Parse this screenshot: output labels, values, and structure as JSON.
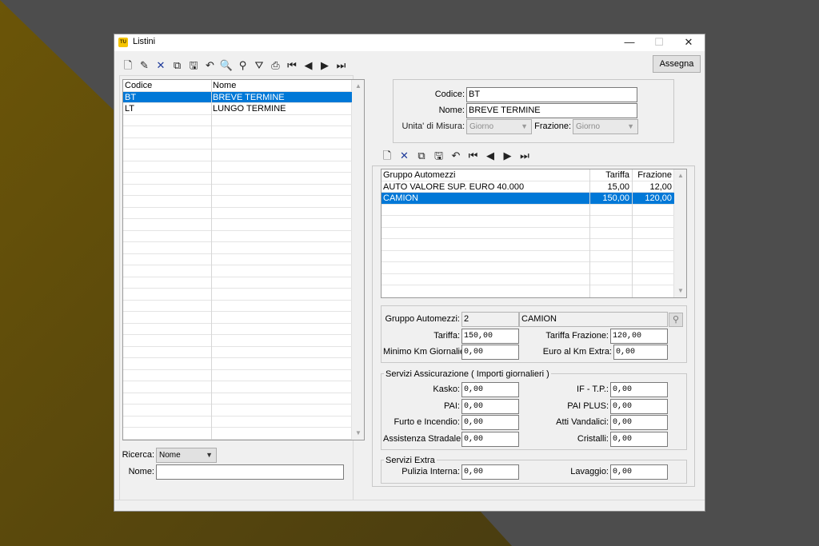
{
  "window": {
    "title": "Listini",
    "icon_text": "TU",
    "controls": {
      "minimize": "—",
      "maximize": "☐",
      "close": "✕"
    }
  },
  "toolbar": {
    "icons": [
      {
        "name": "new-document-icon",
        "glyph": "🗋"
      },
      {
        "name": "edit-pencil-icon",
        "glyph": "✎"
      },
      {
        "name": "delete-x-icon",
        "glyph": "✕"
      },
      {
        "name": "copy-icon",
        "glyph": "⧉"
      },
      {
        "name": "save-disk-icon",
        "glyph": "🖫"
      },
      {
        "name": "undo-icon",
        "glyph": "↶"
      },
      {
        "name": "search-icon",
        "glyph": "🔍"
      },
      {
        "name": "binoculars-icon",
        "glyph": "⚲"
      },
      {
        "name": "filter-icon",
        "glyph": "⛛"
      },
      {
        "name": "print-icon",
        "glyph": "⎙"
      },
      {
        "name": "first-record-icon",
        "glyph": "⏮"
      },
      {
        "name": "prev-record-icon",
        "glyph": "◀"
      },
      {
        "name": "next-record-icon",
        "glyph": "▶"
      },
      {
        "name": "last-record-icon",
        "glyph": "⏭"
      }
    ],
    "assegna_label": "Assegna"
  },
  "list": {
    "columns": [
      "Codice",
      "Nome"
    ],
    "rows": [
      {
        "codice": "BT",
        "nome": "BREVE TERMINE",
        "selected": true
      },
      {
        "codice": "LT",
        "nome": "LUNGO TERMINE",
        "selected": false
      }
    ],
    "empty_rows": 28
  },
  "search": {
    "ricerca_label": "Ricerca:",
    "ricerca_value": "Nome",
    "nome_label": "Nome:",
    "nome_value": ""
  },
  "header_form": {
    "codice_label": "Codice:",
    "codice_value": "BT",
    "nome_label": "Nome:",
    "nome_value": "BREVE TERMINE",
    "unita_label": "Unita' di Misura:",
    "unita_value": "Giorno",
    "frazione_label": "Frazione:",
    "frazione_value": "Giorno"
  },
  "sub_toolbar": {
    "icons": [
      {
        "name": "new-document-icon",
        "glyph": "🗋"
      },
      {
        "name": "delete-x-icon",
        "glyph": "✕"
      },
      {
        "name": "copy-icon",
        "glyph": "⧉"
      },
      {
        "name": "save-disk-icon",
        "glyph": "🖫"
      },
      {
        "name": "undo-icon",
        "glyph": "↶"
      },
      {
        "name": "first-record-icon",
        "glyph": "⏮"
      },
      {
        "name": "prev-record-icon",
        "glyph": "◀"
      },
      {
        "name": "next-record-icon",
        "glyph": "▶"
      },
      {
        "name": "last-record-icon",
        "glyph": "⏭"
      }
    ]
  },
  "tariff_grid": {
    "columns": [
      "Gruppo Automezzi",
      "Tariffa",
      "Frazione"
    ],
    "rows": [
      {
        "gruppo": "AUTO VALORE SUP. EURO 40.000",
        "tariffa": "15,00",
        "frazione": "12,00",
        "selected": false
      },
      {
        "gruppo": "CAMION",
        "tariffa": "150,00",
        "frazione": "120,00",
        "selected": true
      }
    ],
    "empty_rows": 7
  },
  "detail": {
    "gruppo_label": "Gruppo Automezzi:",
    "gruppo_code": "2",
    "gruppo_name": "CAMION",
    "tariffa_label": "Tariffa:",
    "tariffa_value": "150,00",
    "tariffa_frazione_label": "Tariffa Frazione:",
    "tariffa_frazione_value": "120,00",
    "minimo_km_label": "Minimo Km Giornalieri:",
    "minimo_km_value": "0,00",
    "euro_km_label": "Euro al Km Extra:",
    "euro_km_value": "0,00"
  },
  "assicurazione": {
    "title": "Servizi Assicurazione ( Importi giornalieri )",
    "kasko_label": "Kasko:",
    "kasko_value": "0,00",
    "if_tp_label": "IF - T.P.:",
    "if_tp_value": "0,00",
    "pai_label": "PAI:",
    "pai_value": "0,00",
    "pai_plus_label": "PAI PLUS:",
    "pai_plus_value": "0,00",
    "furto_label": "Furto e Incendio:",
    "furto_value": "0,00",
    "atti_label": "Atti Vandalici:",
    "atti_value": "0,00",
    "assistenza_label": "Assistenza Stradale:",
    "assistenza_value": "0,00",
    "cristalli_label": "Cristalli:",
    "cristalli_value": "0,00"
  },
  "extra": {
    "title": "Servizi Extra",
    "pulizia_label": "Pulizia Interna:",
    "pulizia_value": "0,00",
    "lavaggio_label": "Lavaggio:",
    "lavaggio_value": "0,00"
  }
}
